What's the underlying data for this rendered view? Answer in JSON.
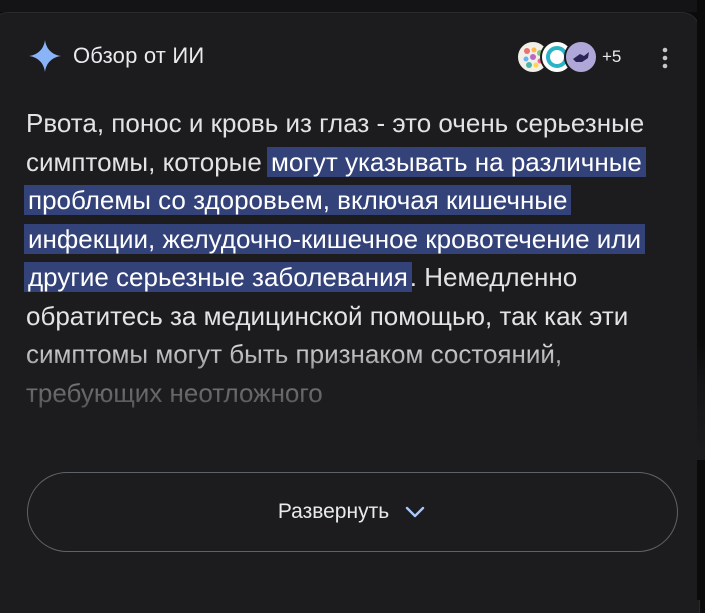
{
  "overview": {
    "title": "Обзор от ИИ",
    "sources_more": "+5",
    "text_before": "Рвота, понос и кровь из глаз - это очень серьезные симптомы, которые ",
    "text_highlight": "могут указывать на различные проблемы со здоровьем, включая кишечные инфекции, желудочно-кишечное кровотечение или другие серьезные заболевания",
    "text_after": ". Немедленно обратитесь за медицинской помощью, так как эти симптомы могут быть признаком состояний, требующих неотложного",
    "expand_label": "Развернуть"
  },
  "icons": {
    "header": "sparkle-icon",
    "sources": [
      "source-favicon-1",
      "source-favicon-2",
      "source-favicon-3"
    ],
    "menu": "more-vert-icon",
    "expand": "chevron-down-icon"
  },
  "colors": {
    "background": "#1c1c1e",
    "highlight": "#34427a",
    "sparkle": "#8ab4f8",
    "button_border": "#5f6368"
  }
}
